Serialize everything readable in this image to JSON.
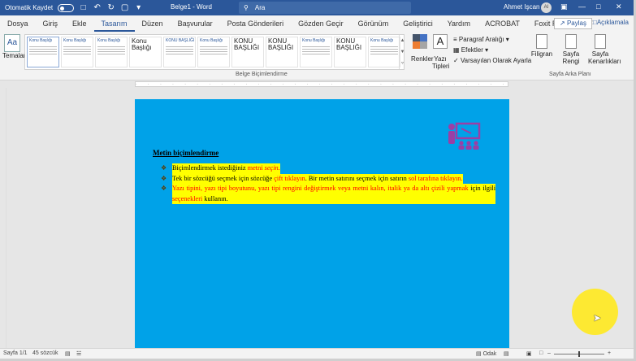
{
  "titlebar": {
    "autosave_label": "Otomatik Kaydet",
    "doc_title": "Belge1  -  Word",
    "search_placeholder": "Ara",
    "user_name": "Ahmet Işcan",
    "user_initials": "AI"
  },
  "menu": {
    "items": [
      "Dosya",
      "Giriş",
      "Ekle",
      "Tasarım",
      "Düzen",
      "Başvurular",
      "Posta Gönderileri",
      "Gözden Geçir",
      "Görünüm",
      "Geliştirici",
      "Yardım",
      "ACROBAT",
      "Foxit Reader PDF"
    ],
    "active": "Tasarım",
    "share_label": "Paylaş",
    "comments_label": "Açıklamala"
  },
  "ribbon": {
    "themes_label": "Temalar",
    "gallery_styles": [
      {
        "title": "Konu Başlığı",
        "big": ""
      },
      {
        "title": "Konu Başlığı",
        "big": ""
      },
      {
        "title": "Konu Başlığı",
        "big": ""
      },
      {
        "title": "",
        "big": "Konu Başlığı"
      },
      {
        "title": "KONU BAŞLIĞI",
        "big": ""
      },
      {
        "title": "Konu Başlığı",
        "big": ""
      },
      {
        "title": "",
        "big": "KONU BAŞLIĞI"
      },
      {
        "title": "",
        "big": "KONU BAŞLIĞI"
      },
      {
        "title": "Konu Başlığı",
        "big": ""
      },
      {
        "title": "",
        "big": "KONU BAŞLIĞI"
      },
      {
        "title": "Konu Başlığı",
        "big": ""
      }
    ],
    "group_formatting_label": "Belge Biçimlendirme",
    "colors_label": "Renkler",
    "fonts_label": "Yazı Tipleri",
    "paragraph_spacing": "Paragraf Aralığı",
    "effects": "Efektler",
    "set_default": "Varsayılan Olarak Ayarla",
    "watermark_label": "Filigran",
    "page_color_label": "Sayfa Rengi",
    "page_borders_label": "Sayfa Kenarlıkları",
    "group_page_bg_label": "Sayfa Arka Planı"
  },
  "document": {
    "heading": "Metin biçimlendirme",
    "bullets": [
      {
        "parts": [
          {
            "t": "Biçimlendirmek istediğiniz ",
            "c": ""
          },
          {
            "t": "metni ",
            "c": "red"
          },
          {
            "t": "seçin.",
            "c": "red it"
          }
        ]
      },
      {
        "parts": [
          {
            "t": "Tek bir sözcüğü seçmek için sözcüğe ",
            "c": ""
          },
          {
            "t": "çift tıklayın",
            "c": "red"
          },
          {
            "t": ". Bir metin satırını seçmek için satırın ",
            "c": ""
          },
          {
            "t": "sol tarafına tıklayın.",
            "c": "red"
          }
        ]
      },
      {
        "parts": [
          {
            "t": "Yazı tipini, yazı tipi boyutunu, yazı tipi rengini değiştirmek veya metni kalın, italik ya da altı çizili yapmak",
            "c": "red"
          },
          {
            "t": " için ilgili ",
            "c": ""
          },
          {
            "t": "seçenekleri",
            "c": "red"
          },
          {
            "t": " kullanın.",
            "c": ""
          }
        ]
      }
    ]
  },
  "statusbar": {
    "page": "Sayfa 1/1",
    "words": "45 sözcük",
    "focus": "Odak"
  },
  "colors": {
    "title_bar": "#2b579a",
    "page_background": "#00a2e8",
    "highlight": "#ffff00",
    "emphasis_text": "#ff0000",
    "cursor_spot": "#ffe923"
  }
}
